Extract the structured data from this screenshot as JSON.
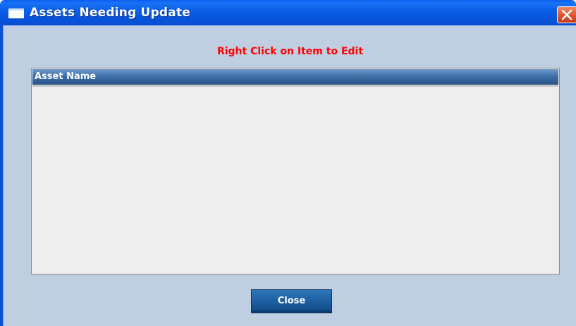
{
  "window": {
    "title": "Assets Needing Update",
    "close_icon": "close-x-icon"
  },
  "instruction": {
    "text": "Right Click on Item to Edit",
    "color": "#ff0000"
  },
  "list": {
    "columns": [
      "Asset Name"
    ],
    "rows": []
  },
  "buttons": {
    "close_label": "Close"
  },
  "colors": {
    "titlebar": "#0a5ef0",
    "client_background": "#bfcfe1",
    "list_header": "#3e6fa6",
    "button": "#1d5fa0"
  }
}
